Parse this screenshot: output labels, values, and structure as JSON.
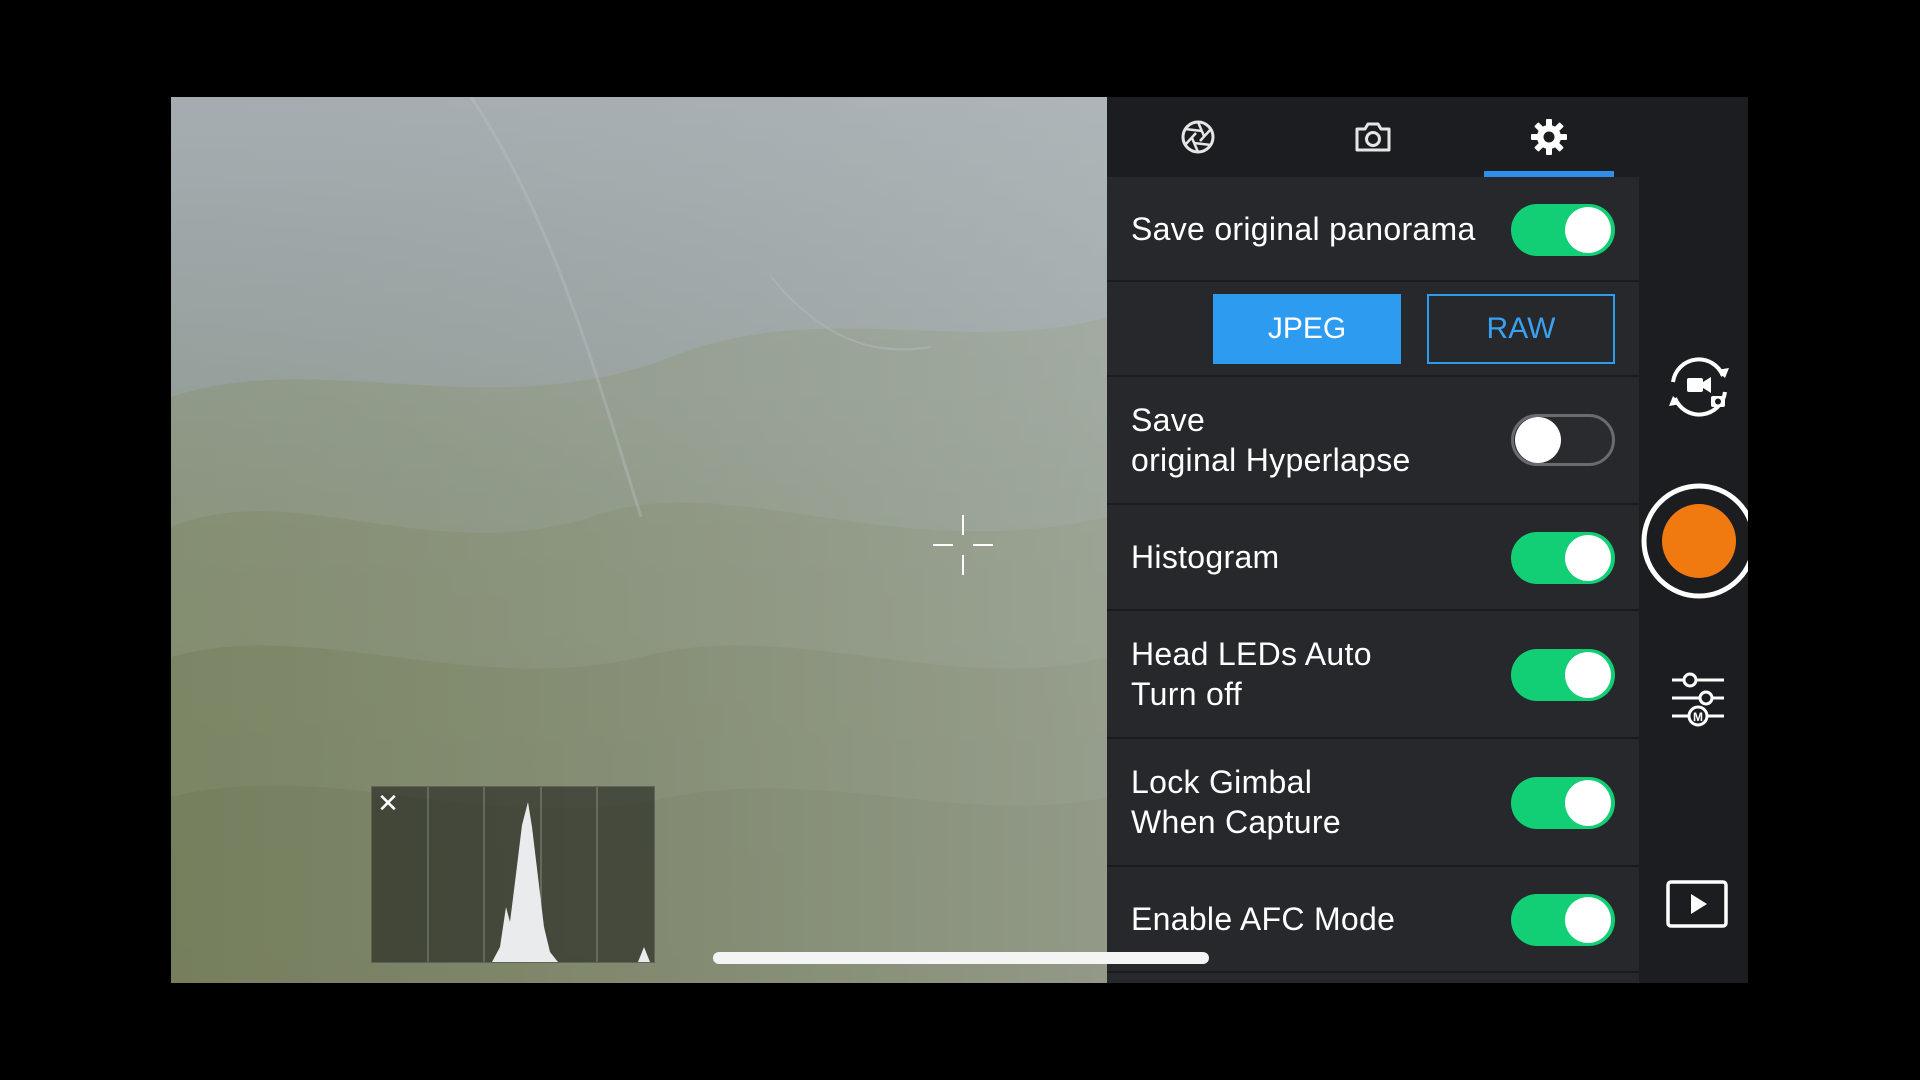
{
  "camera_view": {
    "histogram": {
      "close_glyph": "✕"
    },
    "icons": {
      "crosshair": "crosshair-icon",
      "close": "close-icon"
    }
  },
  "settings_panel": {
    "tabs": [
      {
        "icon": "aperture-icon",
        "active": false
      },
      {
        "icon": "camera-icon",
        "active": false
      },
      {
        "icon": "gear-icon",
        "active": true
      }
    ],
    "save_panorama": {
      "label": "Save original panorama",
      "on": true
    },
    "format": {
      "options": [
        "JPEG",
        "RAW"
      ],
      "selected": "JPEG"
    },
    "save_hyperlapse": {
      "label_line1": "Save",
      "label_line2": "original Hyperlapse",
      "on": false
    },
    "histogram": {
      "label": "Histogram",
      "on": true
    },
    "head_leds": {
      "label_line1": "Head LEDs Auto",
      "label_line2": "Turn off",
      "on": true
    },
    "lock_gimbal": {
      "label_line1": "Lock Gimbal",
      "label_line2": "When Capture",
      "on": true
    },
    "afc_mode": {
      "label": "Enable AFC Mode",
      "on": true
    }
  },
  "controls": {
    "switch_mode": "switch-camera-video-icon",
    "shutter": "shutter-button",
    "manual_settings": "manual-settings-icon",
    "playback": "playback-icon"
  },
  "colors": {
    "accent": "#2f8fe8",
    "toggle_on": "#12cf75",
    "shutter": "#f07a10"
  }
}
